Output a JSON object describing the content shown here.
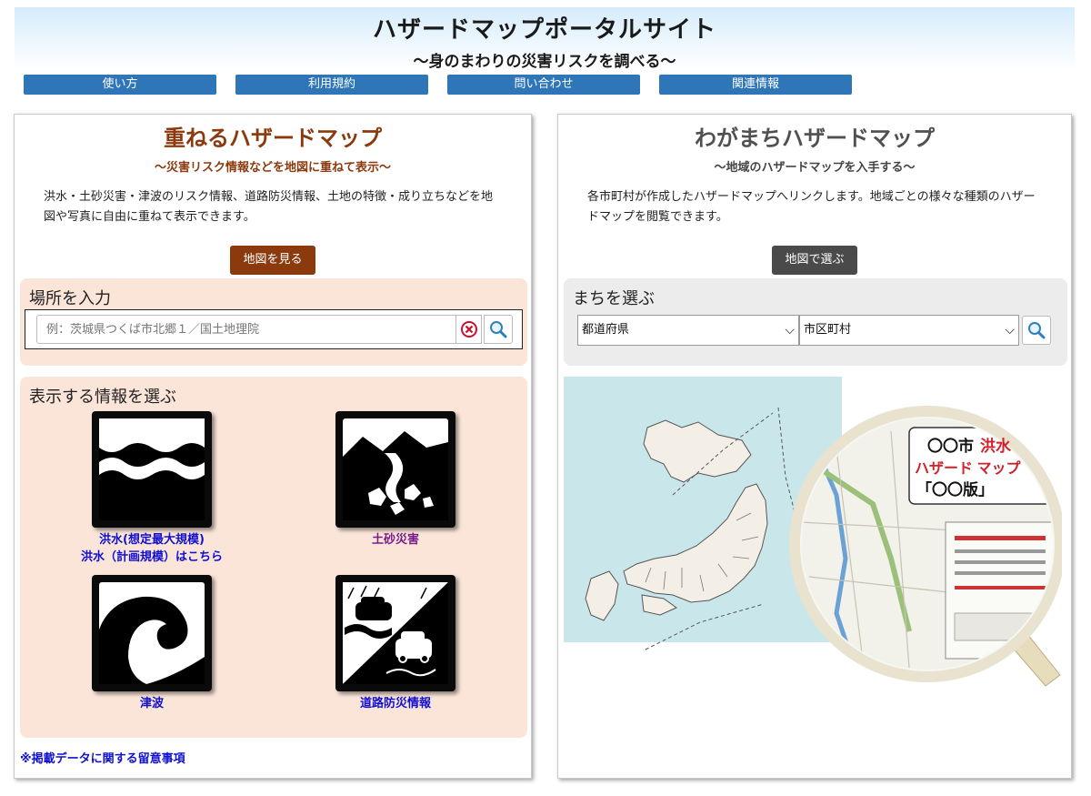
{
  "header": {
    "title": "ハザードマップポータルサイト",
    "subtitle": "～身のまわりの災害リスクを調べる～"
  },
  "nav": [
    {
      "label": "使い方"
    },
    {
      "label": "利用規約"
    },
    {
      "label": "問い合わせ"
    },
    {
      "label": "関連情報"
    }
  ],
  "left": {
    "title": "重ねるハザードマップ",
    "subtitle": "～災害リスク情報などを地図に重ねて表示～",
    "desc": "洪水・土砂災害・津波のリスク情報、道路防災情報、土地の特徴・成り立ちなどを地図や写真に自由に重ねて表示できます。",
    "cta": "地図を見る",
    "search": {
      "title": "場所を入力",
      "placeholder": "例：茨城県つくば市北郷１／国土地理院"
    },
    "info": {
      "title": "表示する情報を選ぶ",
      "tiles": [
        {
          "label1": "洪水(想定最大規模)",
          "label2": "洪水（計画規模）はこちら"
        },
        {
          "label1": "土砂災害"
        },
        {
          "label1": "津波"
        },
        {
          "label1": "道路防災情報"
        }
      ]
    },
    "note": "※掲載データに関する留意事項"
  },
  "right": {
    "title": "わがまちハザードマップ",
    "subtitle": "～地域のハザードマップを入手する～",
    "desc": "各市町村が作成したハザードマップへリンクします。地域ごとの様々な種類のハザードマップを閲覧できます。",
    "cta": "地図で選ぶ",
    "town": {
      "title": "まちを選ぶ",
      "prefecture": "都道府県",
      "city": "市区町村"
    },
    "magnifier": {
      "line1a": "〇〇市",
      "line1b": "洪水",
      "line2": "ハザード マップ",
      "line3": "「〇〇版」"
    }
  }
}
